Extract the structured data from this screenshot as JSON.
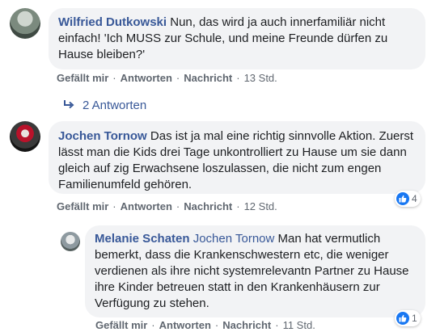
{
  "comments": [
    {
      "author": "Wilfried Dutkowski",
      "text": "Nun, das wird ja auch innerfamiliär nicht einfach! 'Ich MUSS zur Schule, und meine Freunde dürfen zu Hause bleiben?'",
      "time": "13 Std."
    },
    {
      "author": "Jochen Tornow",
      "text": "Das ist ja mal eine richtig sinnvolle Aktion. Zuerst lässt man die Kids drei Tage unkontrolliert zu Hause um sie dann gleich auf zig Erwachsene loszulassen, die nicht zum engen Familienumfeld gehören.",
      "time": "12 Std.",
      "reactions": "4"
    }
  ],
  "reply": {
    "author": "Melanie Schaten",
    "mention": "Jochen Tornow",
    "text": "Man hat vermutlich bemerkt, dass die Krankenschwestern etc, die weniger verdienen als ihre nicht systemrelevantn Partner zu Hause ihre Kinder betreuen statt in den Krankenhäusern zur Verfügung zu stehen.",
    "reactions": "1",
    "time": "11 Std."
  },
  "actions": {
    "like": "Gefällt mir",
    "reply": "Antworten",
    "message": "Nachricht",
    "separator": "·"
  },
  "replies_link": "2 Antworten",
  "colors": {
    "link": "#385898",
    "bubble": "#f2f3f5",
    "muted": "#606770",
    "like_blue": "#1877f2"
  },
  "icons": [
    "reply-arrow-icon",
    "like-thumb-icon"
  ]
}
